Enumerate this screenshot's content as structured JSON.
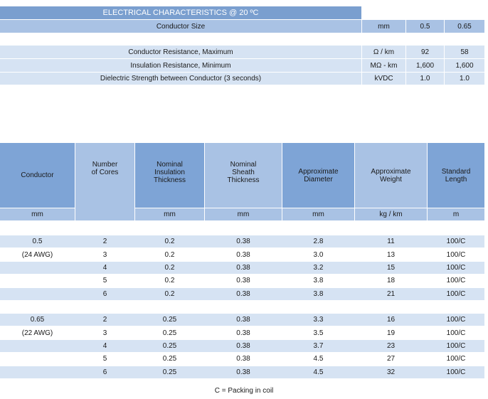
{
  "electrical": {
    "title": "ELECTRICAL CHARACTERISTICS @ 20 ºC",
    "size_row": {
      "label": "Conductor Size",
      "unit": "mm",
      "v1": "0.5",
      "v2": "0.65"
    },
    "rows": [
      {
        "label": "Conductor Resistance, Maximum",
        "unit": "Ω / km",
        "v1": "92",
        "v2": "58"
      },
      {
        "label": "Insulation Resistance, Minimum",
        "unit": "MΩ - km",
        "v1": "1,600",
        "v2": "1,600"
      },
      {
        "label": "Dielectric Strength between Conductor (3 seconds)",
        "unit": "kVDC",
        "v1": "1.0",
        "v2": "1.0"
      }
    ]
  },
  "dimensions": {
    "headers": [
      "Conductor",
      "Number\nof Cores",
      "Nominal\nInsulation\nThickness",
      "Nominal\nSheath\nThickness",
      "Approximate\nDiameter",
      "Approximate\nWeight",
      "Standard\nLength"
    ],
    "units": [
      "mm",
      "",
      "mm",
      "mm",
      "mm",
      "kg / km",
      "m"
    ],
    "groups": [
      {
        "rows": [
          {
            "conductor": "0.5",
            "cores": "2",
            "insulation": "0.2",
            "sheath": "0.38",
            "diameter": "2.8",
            "weight": "11",
            "length": "100/C"
          },
          {
            "conductor": "(24 AWG)",
            "cores": "3",
            "insulation": "0.2",
            "sheath": "0.38",
            "diameter": "3.0",
            "weight": "13",
            "length": "100/C"
          },
          {
            "conductor": "",
            "cores": "4",
            "insulation": "0.2",
            "sheath": "0.38",
            "diameter": "3.2",
            "weight": "15",
            "length": "100/C"
          },
          {
            "conductor": "",
            "cores": "5",
            "insulation": "0.2",
            "sheath": "0.38",
            "diameter": "3.8",
            "weight": "18",
            "length": "100/C"
          },
          {
            "conductor": "",
            "cores": "6",
            "insulation": "0.2",
            "sheath": "0.38",
            "diameter": "3.8",
            "weight": "21",
            "length": "100/C"
          }
        ]
      },
      {
        "rows": [
          {
            "conductor": "0.65",
            "cores": "2",
            "insulation": "0.25",
            "sheath": "0.38",
            "diameter": "3.3",
            "weight": "16",
            "length": "100/C"
          },
          {
            "conductor": "(22 AWG)",
            "cores": "3",
            "insulation": "0.25",
            "sheath": "0.38",
            "diameter": "3.5",
            "weight": "19",
            "length": "100/C"
          },
          {
            "conductor": "",
            "cores": "4",
            "insulation": "0.25",
            "sheath": "0.38",
            "diameter": "3.7",
            "weight": "23",
            "length": "100/C"
          },
          {
            "conductor": "",
            "cores": "5",
            "insulation": "0.25",
            "sheath": "0.38",
            "diameter": "4.5",
            "weight": "27",
            "length": "100/C"
          },
          {
            "conductor": "",
            "cores": "6",
            "insulation": "0.25",
            "sheath": "0.38",
            "diameter": "4.5",
            "weight": "32",
            "length": "100/C"
          }
        ]
      }
    ]
  },
  "footnote": "C = Packing in coil",
  "colors": {
    "title_bar": "#7a9fcf",
    "header_dark": "#7ea4d6",
    "header_mid": "#a9c2e4",
    "band_light": "#d6e3f3"
  }
}
